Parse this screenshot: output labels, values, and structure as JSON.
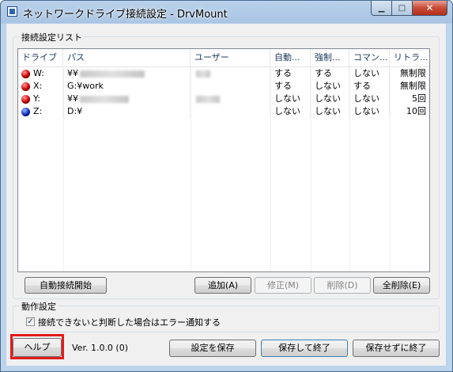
{
  "window": {
    "title": "ネットワークドライブ接続設定 - DrvMount",
    "min_glyph": "▁",
    "max_glyph": "□",
    "close_glyph": "✕"
  },
  "connection_list": {
    "group_label": "接続設定リスト",
    "columns": [
      "ドライブ",
      "パス",
      "ユーザー",
      "自動...",
      "強制...",
      "コマン...",
      "リトラ..."
    ],
    "rows": [
      {
        "drive": "W:",
        "ball": "red",
        "path": "¥¥",
        "path_redacted": true,
        "user_redacted": true,
        "auto": "する",
        "force": "する",
        "command": "しない",
        "retry": "無制限"
      },
      {
        "drive": "X:",
        "ball": "red",
        "path": "G:¥work",
        "path_redacted": false,
        "user_redacted": false,
        "auto": "する",
        "force": "しない",
        "command": "する",
        "retry": "無制限"
      },
      {
        "drive": "Y:",
        "ball": "red",
        "path": "¥¥",
        "path_redacted": true,
        "user_redacted": true,
        "auto": "しない",
        "force": "しない",
        "command": "しない",
        "retry": "5回"
      },
      {
        "drive": "Z:",
        "ball": "blue",
        "path": "D:¥",
        "path_redacted": false,
        "user_redacted": false,
        "auto": "しない",
        "force": "しない",
        "command": "しない",
        "retry": "10回"
      }
    ]
  },
  "list_buttons": {
    "auto_connect": "自動接続開始",
    "add": "追加(A)",
    "edit": "修正(M)",
    "delete": "削除(D)",
    "delete_all": "全削除(E)"
  },
  "behavior": {
    "group_label": "動作設定",
    "notify_checkbox_label": "接続できないと判断した場合はエラー通知する",
    "notify_checked": true
  },
  "footer": {
    "help": "ヘルプ",
    "version": "Ver. 1.0.0 (0)",
    "save_settings": "設定を保存",
    "save_and_exit": "保存して終了",
    "exit_without_save": "保存せずに終了"
  },
  "colors": {
    "highlight": "#e21b1b",
    "drive_red": "#e00000",
    "drive_blue": "#1030d0"
  }
}
